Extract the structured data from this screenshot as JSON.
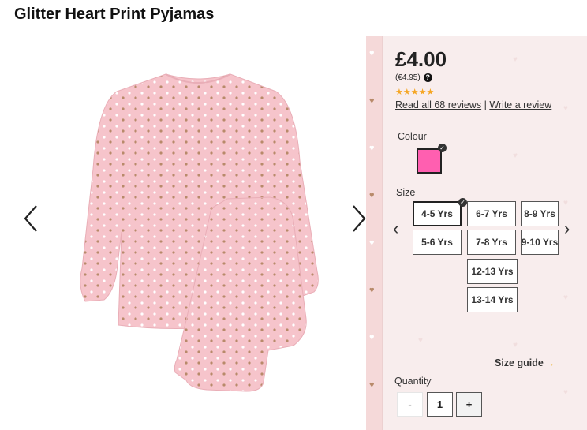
{
  "product": {
    "title": "Glitter Heart Print Pyjamas"
  },
  "gallery": {
    "prev_icon": "chevron-left-icon",
    "next_icon": "chevron-right-icon"
  },
  "pricing": {
    "price": "£4.00",
    "euro_price": "(€4.95)",
    "help_icon": "question-mark-icon",
    "rating": 4.5,
    "stars": "★★★★★"
  },
  "reviews": {
    "read_all": "Read all 68 reviews",
    "separator": "|",
    "write": "Write a review"
  },
  "colour": {
    "label": "Colour",
    "selected_color": "#ff5fb0"
  },
  "size": {
    "label": "Size",
    "options": [
      "4-5 Yrs",
      "6-7 Yrs",
      "8-9 Yrs",
      "5-6 Yrs",
      "7-8 Yrs",
      "9-10 Yrs",
      "12-13 Yrs",
      "13-14 Yrs"
    ],
    "selected": "4-5 Yrs"
  },
  "size_guide": {
    "label": "Size guide",
    "arrow": "→"
  },
  "quantity": {
    "label": "Quantity",
    "minus": "-",
    "value": "1",
    "plus": "+"
  },
  "colors": {
    "pyjama_pink": "#f6c4cb",
    "panel_bg": "#f8eded",
    "star": "#f5a623",
    "swatch": "#ff5fb0"
  }
}
